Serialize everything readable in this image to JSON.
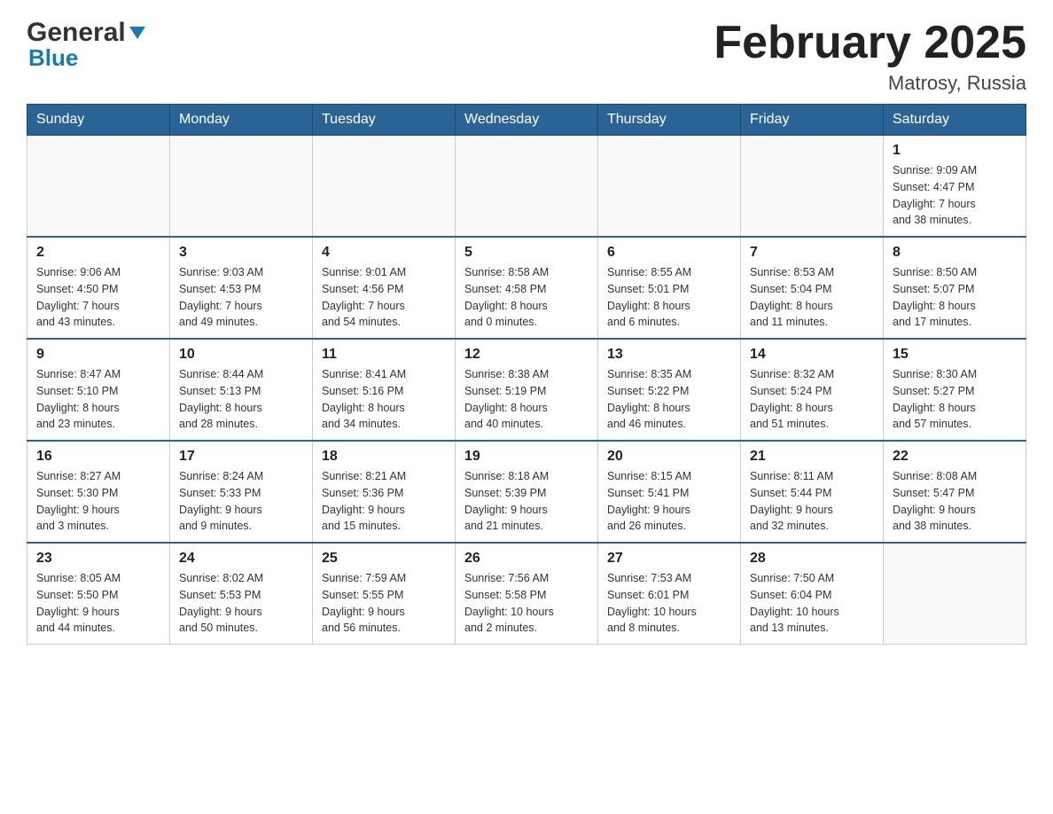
{
  "header": {
    "logo_general": "General",
    "logo_blue": "Blue",
    "month_year": "February 2025",
    "location": "Matrosy, Russia"
  },
  "weekdays": [
    "Sunday",
    "Monday",
    "Tuesday",
    "Wednesday",
    "Thursday",
    "Friday",
    "Saturday"
  ],
  "weeks": [
    [
      {
        "day": "",
        "info": ""
      },
      {
        "day": "",
        "info": ""
      },
      {
        "day": "",
        "info": ""
      },
      {
        "day": "",
        "info": ""
      },
      {
        "day": "",
        "info": ""
      },
      {
        "day": "",
        "info": ""
      },
      {
        "day": "1",
        "info": "Sunrise: 9:09 AM\nSunset: 4:47 PM\nDaylight: 7 hours\nand 38 minutes."
      }
    ],
    [
      {
        "day": "2",
        "info": "Sunrise: 9:06 AM\nSunset: 4:50 PM\nDaylight: 7 hours\nand 43 minutes."
      },
      {
        "day": "3",
        "info": "Sunrise: 9:03 AM\nSunset: 4:53 PM\nDaylight: 7 hours\nand 49 minutes."
      },
      {
        "day": "4",
        "info": "Sunrise: 9:01 AM\nSunset: 4:56 PM\nDaylight: 7 hours\nand 54 minutes."
      },
      {
        "day": "5",
        "info": "Sunrise: 8:58 AM\nSunset: 4:58 PM\nDaylight: 8 hours\nand 0 minutes."
      },
      {
        "day": "6",
        "info": "Sunrise: 8:55 AM\nSunset: 5:01 PM\nDaylight: 8 hours\nand 6 minutes."
      },
      {
        "day": "7",
        "info": "Sunrise: 8:53 AM\nSunset: 5:04 PM\nDaylight: 8 hours\nand 11 minutes."
      },
      {
        "day": "8",
        "info": "Sunrise: 8:50 AM\nSunset: 5:07 PM\nDaylight: 8 hours\nand 17 minutes."
      }
    ],
    [
      {
        "day": "9",
        "info": "Sunrise: 8:47 AM\nSunset: 5:10 PM\nDaylight: 8 hours\nand 23 minutes."
      },
      {
        "day": "10",
        "info": "Sunrise: 8:44 AM\nSunset: 5:13 PM\nDaylight: 8 hours\nand 28 minutes."
      },
      {
        "day": "11",
        "info": "Sunrise: 8:41 AM\nSunset: 5:16 PM\nDaylight: 8 hours\nand 34 minutes."
      },
      {
        "day": "12",
        "info": "Sunrise: 8:38 AM\nSunset: 5:19 PM\nDaylight: 8 hours\nand 40 minutes."
      },
      {
        "day": "13",
        "info": "Sunrise: 8:35 AM\nSunset: 5:22 PM\nDaylight: 8 hours\nand 46 minutes."
      },
      {
        "day": "14",
        "info": "Sunrise: 8:32 AM\nSunset: 5:24 PM\nDaylight: 8 hours\nand 51 minutes."
      },
      {
        "day": "15",
        "info": "Sunrise: 8:30 AM\nSunset: 5:27 PM\nDaylight: 8 hours\nand 57 minutes."
      }
    ],
    [
      {
        "day": "16",
        "info": "Sunrise: 8:27 AM\nSunset: 5:30 PM\nDaylight: 9 hours\nand 3 minutes."
      },
      {
        "day": "17",
        "info": "Sunrise: 8:24 AM\nSunset: 5:33 PM\nDaylight: 9 hours\nand 9 minutes."
      },
      {
        "day": "18",
        "info": "Sunrise: 8:21 AM\nSunset: 5:36 PM\nDaylight: 9 hours\nand 15 minutes."
      },
      {
        "day": "19",
        "info": "Sunrise: 8:18 AM\nSunset: 5:39 PM\nDaylight: 9 hours\nand 21 minutes."
      },
      {
        "day": "20",
        "info": "Sunrise: 8:15 AM\nSunset: 5:41 PM\nDaylight: 9 hours\nand 26 minutes."
      },
      {
        "day": "21",
        "info": "Sunrise: 8:11 AM\nSunset: 5:44 PM\nDaylight: 9 hours\nand 32 minutes."
      },
      {
        "day": "22",
        "info": "Sunrise: 8:08 AM\nSunset: 5:47 PM\nDaylight: 9 hours\nand 38 minutes."
      }
    ],
    [
      {
        "day": "23",
        "info": "Sunrise: 8:05 AM\nSunset: 5:50 PM\nDaylight: 9 hours\nand 44 minutes."
      },
      {
        "day": "24",
        "info": "Sunrise: 8:02 AM\nSunset: 5:53 PM\nDaylight: 9 hours\nand 50 minutes."
      },
      {
        "day": "25",
        "info": "Sunrise: 7:59 AM\nSunset: 5:55 PM\nDaylight: 9 hours\nand 56 minutes."
      },
      {
        "day": "26",
        "info": "Sunrise: 7:56 AM\nSunset: 5:58 PM\nDaylight: 10 hours\nand 2 minutes."
      },
      {
        "day": "27",
        "info": "Sunrise: 7:53 AM\nSunset: 6:01 PM\nDaylight: 10 hours\nand 8 minutes."
      },
      {
        "day": "28",
        "info": "Sunrise: 7:50 AM\nSunset: 6:04 PM\nDaylight: 10 hours\nand 13 minutes."
      },
      {
        "day": "",
        "info": ""
      }
    ]
  ]
}
